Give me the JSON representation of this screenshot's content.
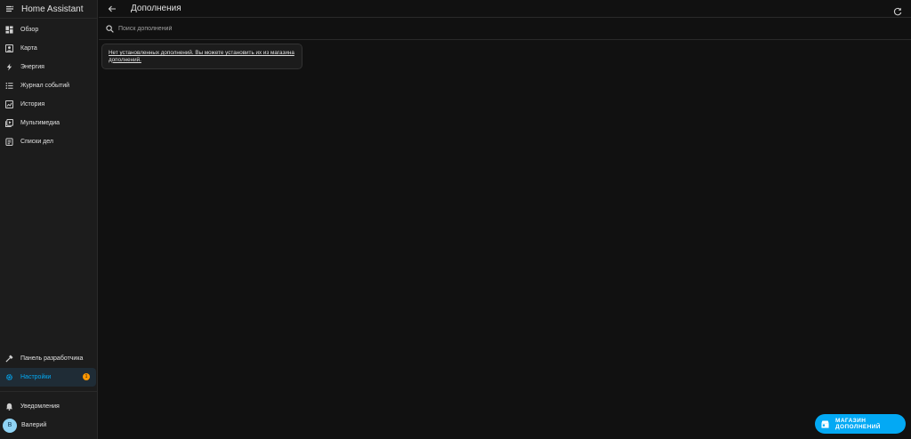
{
  "app": {
    "title": "Home Assistant"
  },
  "sidebar": {
    "items": [
      {
        "label": "Обзор",
        "icon": "dashboard-icon"
      },
      {
        "label": "Карта",
        "icon": "map-icon"
      },
      {
        "label": "Энергия",
        "icon": "lightning-icon"
      },
      {
        "label": "Журнал событий",
        "icon": "list-icon"
      },
      {
        "label": "История",
        "icon": "chart-icon"
      },
      {
        "label": "Мультимедиа",
        "icon": "media-icon"
      },
      {
        "label": "Списки дел",
        "icon": "clipboard-icon"
      }
    ],
    "bottom": [
      {
        "label": "Панель разработчика",
        "icon": "hammer-icon"
      },
      {
        "label": "Настройки",
        "icon": "gear-icon",
        "badge": "1",
        "active": true
      }
    ],
    "notifications": {
      "label": "Уведомления",
      "icon": "bell-icon"
    },
    "user": {
      "initial": "В",
      "name": "Валерий"
    }
  },
  "header": {
    "title": "Дополнения"
  },
  "search": {
    "placeholder": "Поиск дополнений"
  },
  "notice": {
    "text": "Нет установленных дополнений. Вы можете установить их из магазина дополнений."
  },
  "store_button": {
    "label": "МАГАЗИН ДОПОЛНЕНИЙ"
  },
  "colors": {
    "accent": "#03a9f4",
    "badge": "#ff9800",
    "background": "#111111",
    "sidebar": "#1c1c1c"
  }
}
